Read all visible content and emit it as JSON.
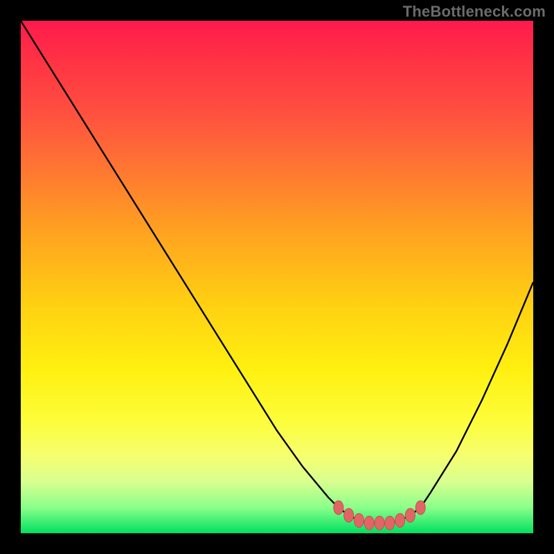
{
  "watermark": "TheBottleneck.com",
  "colors": {
    "background": "#000000",
    "curve_stroke": "#000000",
    "marker_fill": "#e06666",
    "marker_stroke": "#c94f4f"
  },
  "chart_data": {
    "type": "line",
    "title": "",
    "xlabel": "",
    "ylabel": "",
    "xlim": [
      0,
      100
    ],
    "ylim": [
      0,
      100
    ],
    "grid": false,
    "legend": false,
    "x": [
      0,
      5,
      10,
      15,
      20,
      25,
      30,
      35,
      40,
      45,
      50,
      55,
      60,
      62,
      64,
      66,
      68,
      70,
      72,
      74,
      76,
      78,
      80,
      85,
      90,
      95,
      100
    ],
    "values": [
      100,
      92,
      84,
      76,
      68,
      60,
      52,
      44,
      36,
      28,
      20,
      13,
      7,
      5,
      3.5,
      2.5,
      2,
      2,
      2,
      2.5,
      3.5,
      5,
      8,
      16,
      26,
      37,
      49
    ],
    "annotations": {
      "flat_region_markers_x": [
        62,
        64,
        66,
        68,
        70,
        72,
        74,
        76,
        78
      ],
      "flat_region_markers_y": [
        5,
        3.5,
        2.5,
        2,
        2,
        2,
        2.5,
        3.5,
        5
      ]
    }
  }
}
